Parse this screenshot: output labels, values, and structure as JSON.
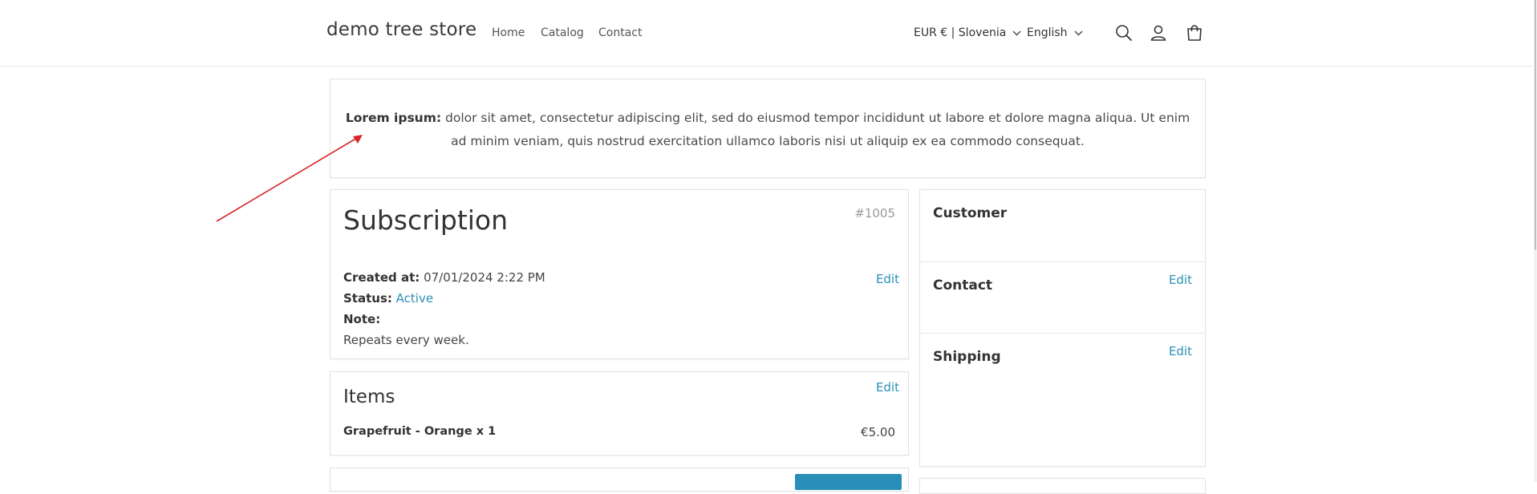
{
  "header": {
    "logo": "demo tree store",
    "nav": [
      "Home",
      "Catalog",
      "Contact"
    ],
    "currency": "EUR € | Slovenia",
    "language": "English",
    "icons": [
      "search-icon",
      "account-icon",
      "cart-icon"
    ]
  },
  "announcement": {
    "bold": "Lorem ipsum:",
    "text": "dolor sit amet, consectetur adipiscing elit, sed do eiusmod tempor incididunt ut labore et dolore magna aliqua. Ut enim ad minim veniam, quis nostrud exercitation ullamco laboris nisi ut aliquip ex ea commodo consequat."
  },
  "subscription": {
    "title": "Subscription",
    "number": "#1005",
    "edit": "Edit",
    "created_label": "Created at:",
    "created_value": "07/01/2024 2:22 PM",
    "status_label": "Status:",
    "status_value": "Active",
    "note_label": "Note:",
    "note_value": "Repeats every week."
  },
  "items": {
    "title": "Items",
    "edit": "Edit",
    "list": [
      {
        "name": "Grapefruit - Orange x 1",
        "price": "€5.00"
      }
    ]
  },
  "sidebar": {
    "customer": {
      "title": "Customer"
    },
    "contact": {
      "title": "Contact",
      "edit": "Edit"
    },
    "shipping": {
      "title": "Shipping",
      "edit": "Edit"
    }
  },
  "colors": {
    "accent": "#2a8fb8",
    "annotation_arrow": "#d9262a",
    "border": "#e3e3e3"
  }
}
